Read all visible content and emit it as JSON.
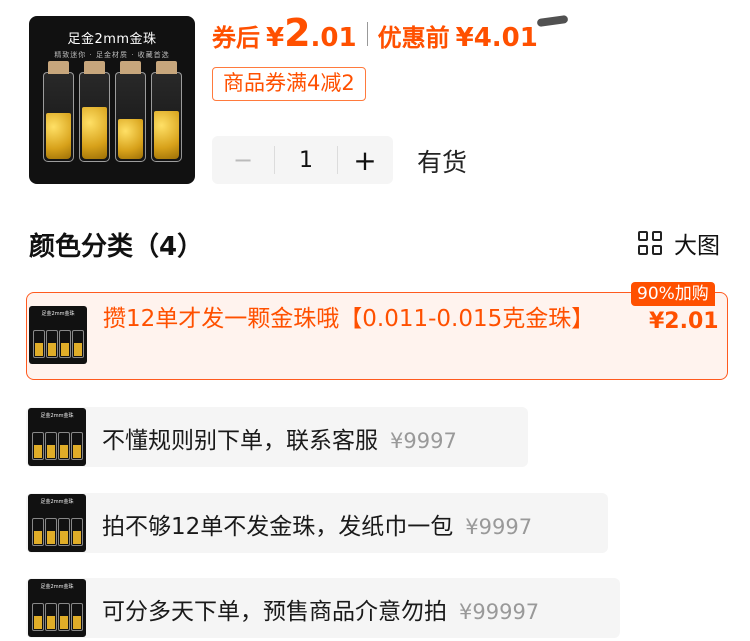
{
  "product": {
    "image_caption": "足金2mm金珠",
    "image_subcaption": "精致迷你 · 足金材质 · 收藏首选",
    "price_after_label": "券后",
    "price_after_currency": "¥",
    "price_after_integer": "2",
    "price_after_decimal": ".01",
    "price_before_label": "优惠前",
    "price_before": "¥4.01",
    "coupon": "商品券满4减2",
    "quantity": "1",
    "stock_status": "有货"
  },
  "stepper": {
    "minus_icon": "−",
    "plus_icon": "+"
  },
  "section": {
    "title": "颜色分类（4）",
    "view_toggle_label": "大图",
    "view_toggle_icon": "grid-icon"
  },
  "options": [
    {
      "label": "攒12单才发一颗金珠哦【0.011-0.015克金珠】",
      "price": "¥2.01",
      "badge": "90%加购",
      "selected": true
    },
    {
      "label": "不懂规则别下单，联系客服",
      "price": "¥9997",
      "selected": false
    },
    {
      "label": "拍不够12单不发金珠，发纸巾一包",
      "price": "¥9997",
      "selected": false
    },
    {
      "label": "可分多天下单，预售商品介意勿拍",
      "price": "¥99997",
      "selected": false
    }
  ],
  "colors": {
    "accent": "#ff5000",
    "selected_bg": "#fff3ee",
    "option_bg": "#f5f5f5"
  }
}
